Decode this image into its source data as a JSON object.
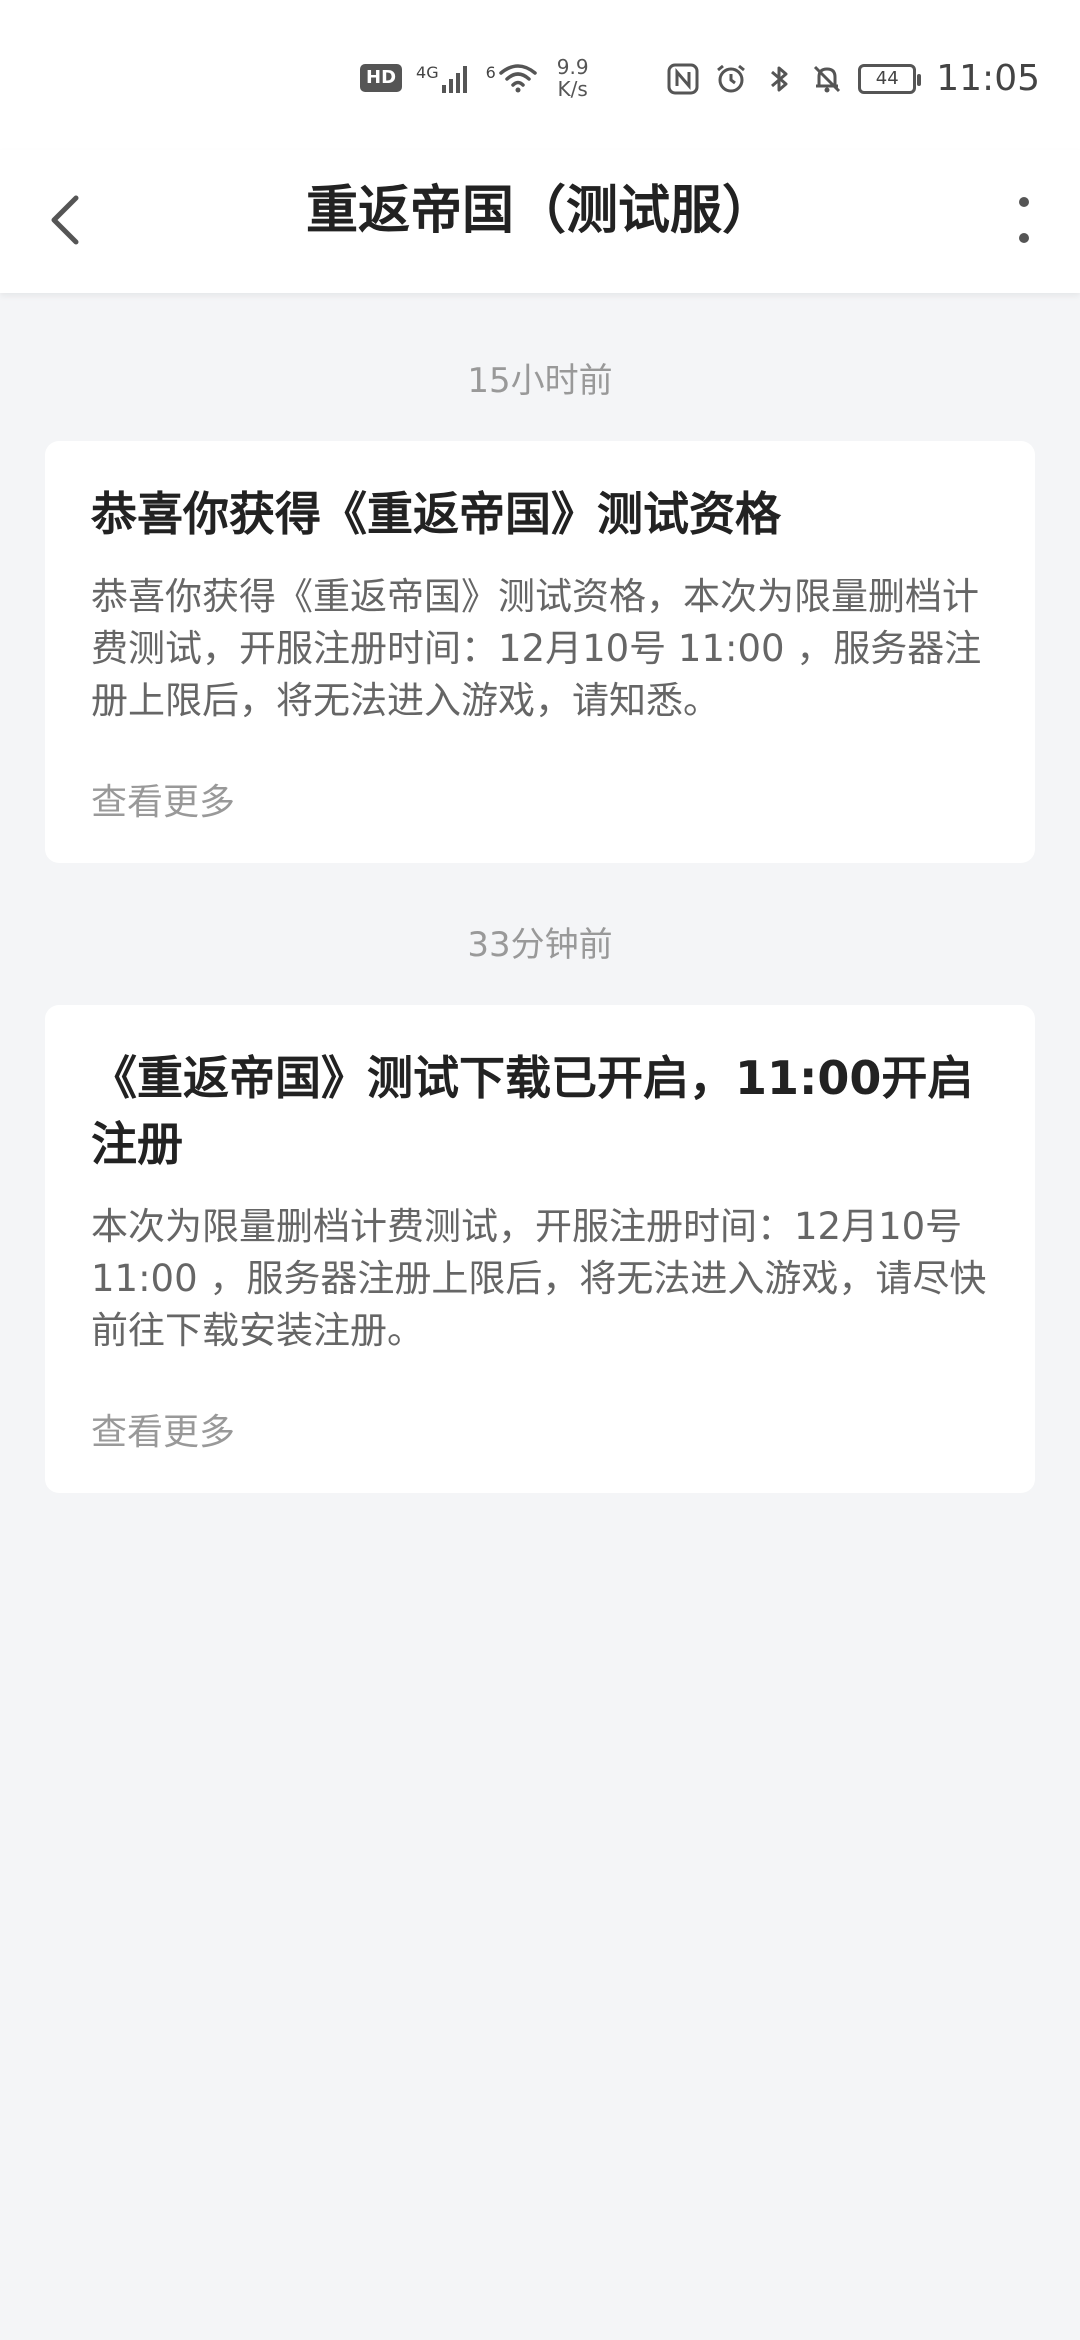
{
  "status_bar": {
    "hd_badge": "HD",
    "network_1": "4G",
    "network_2": "6",
    "speed_value": "9.9",
    "speed_unit": "K/s",
    "battery_level": "44",
    "time": "11:05"
  },
  "app_bar": {
    "title": "重返帝国（测试服）",
    "back_icon": "chevron-left-icon",
    "more_icon": "more-vertical-icon"
  },
  "messages": [
    {
      "timestamp": "15小时前",
      "title": "恭喜你获得《重返帝国》测试资格",
      "body": "恭喜你获得《重返帝国》测试资格，本次为限量删档计费测试，开服注册时间：12月10号 11:00 ，服务器注册上限后，将无法进入游戏，请知悉。",
      "more_label": "查看更多"
    },
    {
      "timestamp": "33分钟前",
      "title": "《重返帝国》测试下载已开启，11:00开启注册",
      "body": "本次为限量删档计费测试，开服注册时间：12月10号 11:00 ，服务器注册上限后，将无法进入游戏，请尽快前往下载安装注册。",
      "more_label": "查看更多"
    }
  ]
}
